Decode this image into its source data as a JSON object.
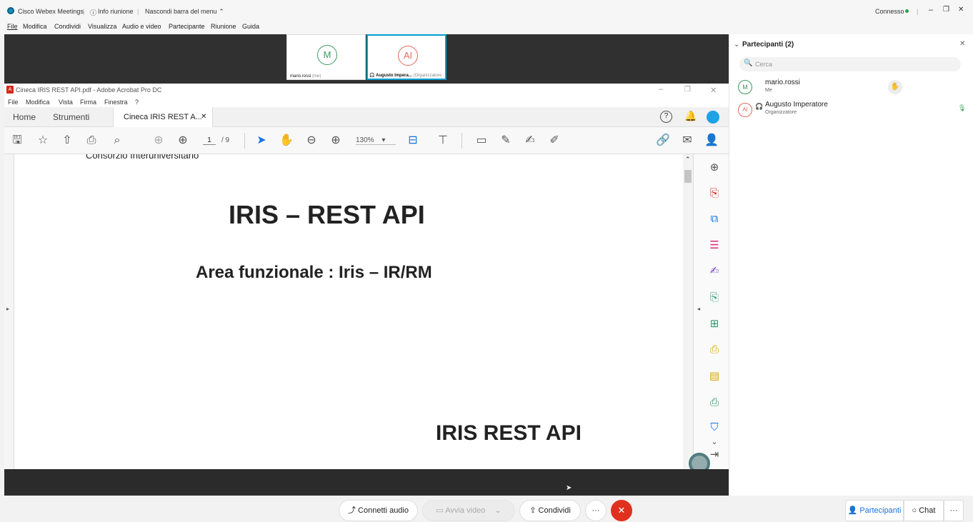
{
  "titlebar": {
    "app_name": "Cisco Webex Meetings",
    "info": "Info riunione",
    "hide_menu": "Nascondi barra del menu",
    "status": "Connesso"
  },
  "menubar": [
    "File",
    "Modifica",
    "Condividi",
    "Visualizza",
    "Audio e video",
    "Partecipante",
    "Riunione",
    "Guida"
  ],
  "tiles": [
    {
      "initial": "M",
      "name": "mario.rossi",
      "suffix": "(me)"
    },
    {
      "initial": "AI",
      "name": "Augusto Impera...",
      "suffix": "(Organizzatore"
    }
  ],
  "acrobat": {
    "title": "Cineca IRIS REST API.pdf - Adobe Acrobat Pro DC",
    "menu": [
      "File",
      "Modifica",
      "Vista",
      "Firma",
      "Finestra",
      "?"
    ],
    "tabs": [
      "Home",
      "Strumenti",
      "Cineca IRIS REST A..."
    ],
    "page_current": "1",
    "page_total": "/ 9",
    "zoom": "130%",
    "doc": {
      "header_cut": "Consorzio Interuniversitario",
      "title": "IRIS – REST API",
      "subtitle": "Area funzionale : Iris – IR/RM",
      "footer": "IRIS REST API"
    }
  },
  "controls": {
    "audio": "Connetti audio",
    "video": "Avvia video",
    "share": "Condividi",
    "participants": "Partecipanti",
    "chat": "Chat",
    "more": "···"
  },
  "panel": {
    "title": "Partecipanti (2)",
    "search_placeholder": "Cerca",
    "participants": [
      {
        "initial": "M",
        "name": "mario.rossi",
        "role": "Me"
      },
      {
        "initial": "AI",
        "name": "Augusto Imperatore",
        "role": "Organizzatore"
      }
    ]
  },
  "colors": {
    "accent": "#00a0d1",
    "end_call": "#e0301e",
    "acrobat_red": "#d9261c"
  }
}
